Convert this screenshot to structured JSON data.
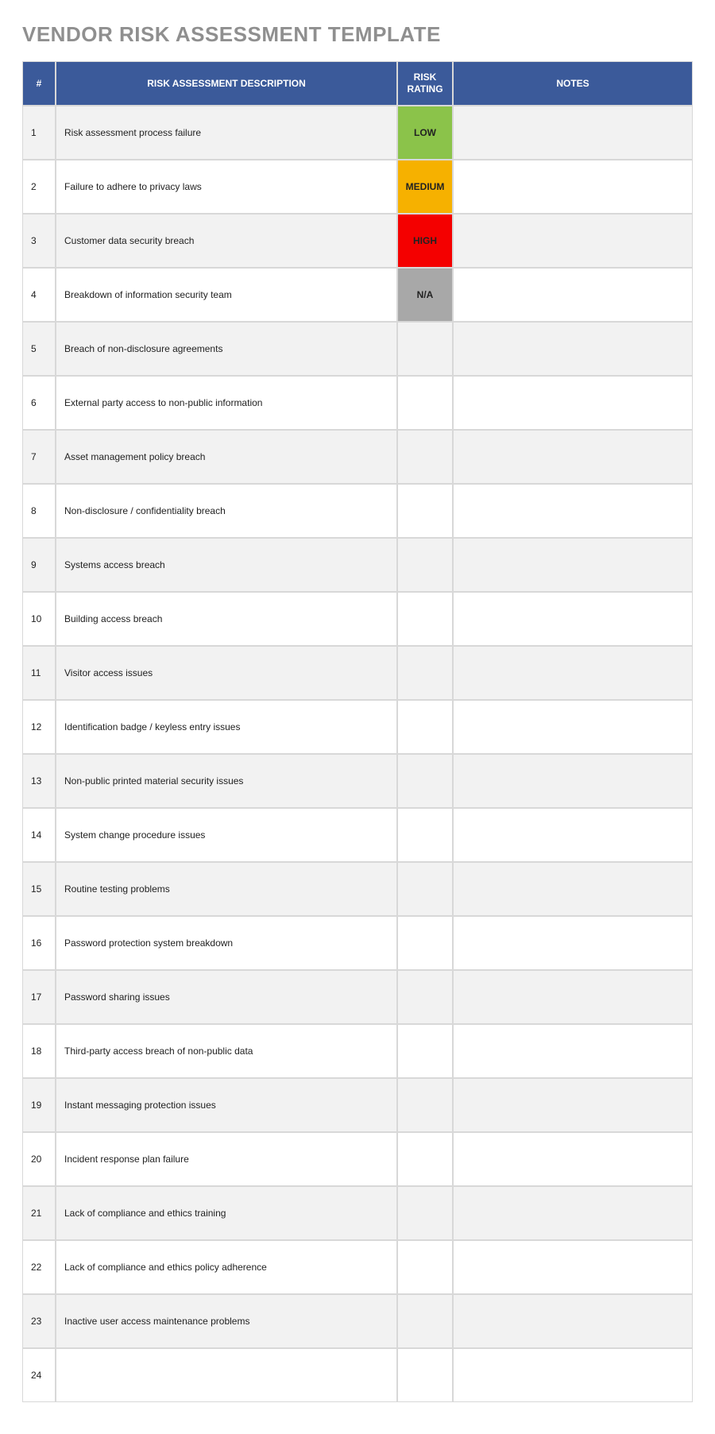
{
  "title": "VENDOR RISK ASSESSMENT TEMPLATE",
  "headers": {
    "num": "#",
    "description": "RISK ASSESSMENT DESCRIPTION",
    "risk": "RISK RATING",
    "notes": "NOTES"
  },
  "risk_levels": {
    "LOW": {
      "label": "LOW",
      "class": "risk-LOW"
    },
    "MEDIUM": {
      "label": "MEDIUM",
      "class": "risk-MEDIUM"
    },
    "HIGH": {
      "label": "HIGH",
      "class": "risk-HIGH"
    },
    "NA": {
      "label": "N/A",
      "class": "risk-NA"
    }
  },
  "rows": [
    {
      "num": "1",
      "description": "Risk assessment process failure",
      "risk": "LOW",
      "notes": ""
    },
    {
      "num": "2",
      "description": "Failure to adhere to privacy laws",
      "risk": "MEDIUM",
      "notes": ""
    },
    {
      "num": "3",
      "description": "Customer data security breach",
      "risk": "HIGH",
      "notes": ""
    },
    {
      "num": "4",
      "description": "Breakdown of information security team",
      "risk": "NA",
      "notes": ""
    },
    {
      "num": "5",
      "description": "Breach of non-disclosure agreements",
      "risk": "",
      "notes": ""
    },
    {
      "num": "6",
      "description": "External party access to non-public information",
      "risk": "",
      "notes": ""
    },
    {
      "num": "7",
      "description": "Asset management policy breach",
      "risk": "",
      "notes": ""
    },
    {
      "num": "8",
      "description": "Non-disclosure / confidentiality breach",
      "risk": "",
      "notes": ""
    },
    {
      "num": "9",
      "description": "Systems access breach",
      "risk": "",
      "notes": ""
    },
    {
      "num": "10",
      "description": "Building access breach",
      "risk": "",
      "notes": ""
    },
    {
      "num": "11",
      "description": "Visitor access issues",
      "risk": "",
      "notes": ""
    },
    {
      "num": "12",
      "description": "Identification badge / keyless entry issues",
      "risk": "",
      "notes": ""
    },
    {
      "num": "13",
      "description": "Non-public printed material security issues",
      "risk": "",
      "notes": ""
    },
    {
      "num": "14",
      "description": "System change procedure issues",
      "risk": "",
      "notes": ""
    },
    {
      "num": "15",
      "description": "Routine testing problems",
      "risk": "",
      "notes": ""
    },
    {
      "num": "16",
      "description": "Password protection system breakdown",
      "risk": "",
      "notes": ""
    },
    {
      "num": "17",
      "description": "Password sharing issues",
      "risk": "",
      "notes": ""
    },
    {
      "num": "18",
      "description": "Third-party access breach of non-public data",
      "risk": "",
      "notes": ""
    },
    {
      "num": "19",
      "description": "Instant messaging protection issues",
      "risk": "",
      "notes": ""
    },
    {
      "num": "20",
      "description": "Incident response plan failure",
      "risk": "",
      "notes": ""
    },
    {
      "num": "21",
      "description": "Lack of compliance and ethics training",
      "risk": "",
      "notes": ""
    },
    {
      "num": "22",
      "description": "Lack of compliance and ethics policy adherence",
      "risk": "",
      "notes": ""
    },
    {
      "num": "23",
      "description": "Inactive user access maintenance problems",
      "risk": "",
      "notes": ""
    },
    {
      "num": "24",
      "description": "",
      "risk": "",
      "notes": ""
    }
  ]
}
